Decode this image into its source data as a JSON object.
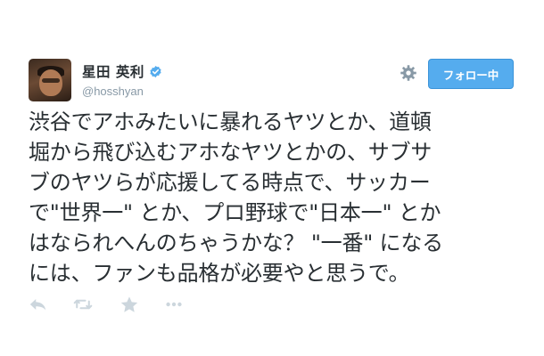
{
  "user": {
    "full_name": "星田 英利",
    "screen_name": "@hosshyan",
    "verified": true
  },
  "follow_button": {
    "label": "フォロー中"
  },
  "icons": {
    "settings": "gear-icon",
    "verified": "verified-badge-icon",
    "reply": "reply-icon",
    "retweet": "retweet-icon",
    "favorite": "star-icon",
    "more": "more-icon"
  },
  "tweet": {
    "lines": [
      "渋谷でアホみたいに暴れるヤツとか、道頓",
      "堀から飛び込むアホなヤツとかの、サブサ",
      "ブのヤツらが応援してる時点で、サッカー",
      "で\"世界一\" とか、プロ野球で\"日本一\" とか",
      "はなられへんのちゃうかな？ \"一番\" になる",
      "には、ファンも品格が必要やと思うで。"
    ]
  },
  "colors": {
    "accent": "#55acee",
    "text": "#292f33",
    "muted": "#8899a6",
    "icon_muted": "#ccd6dd"
  }
}
